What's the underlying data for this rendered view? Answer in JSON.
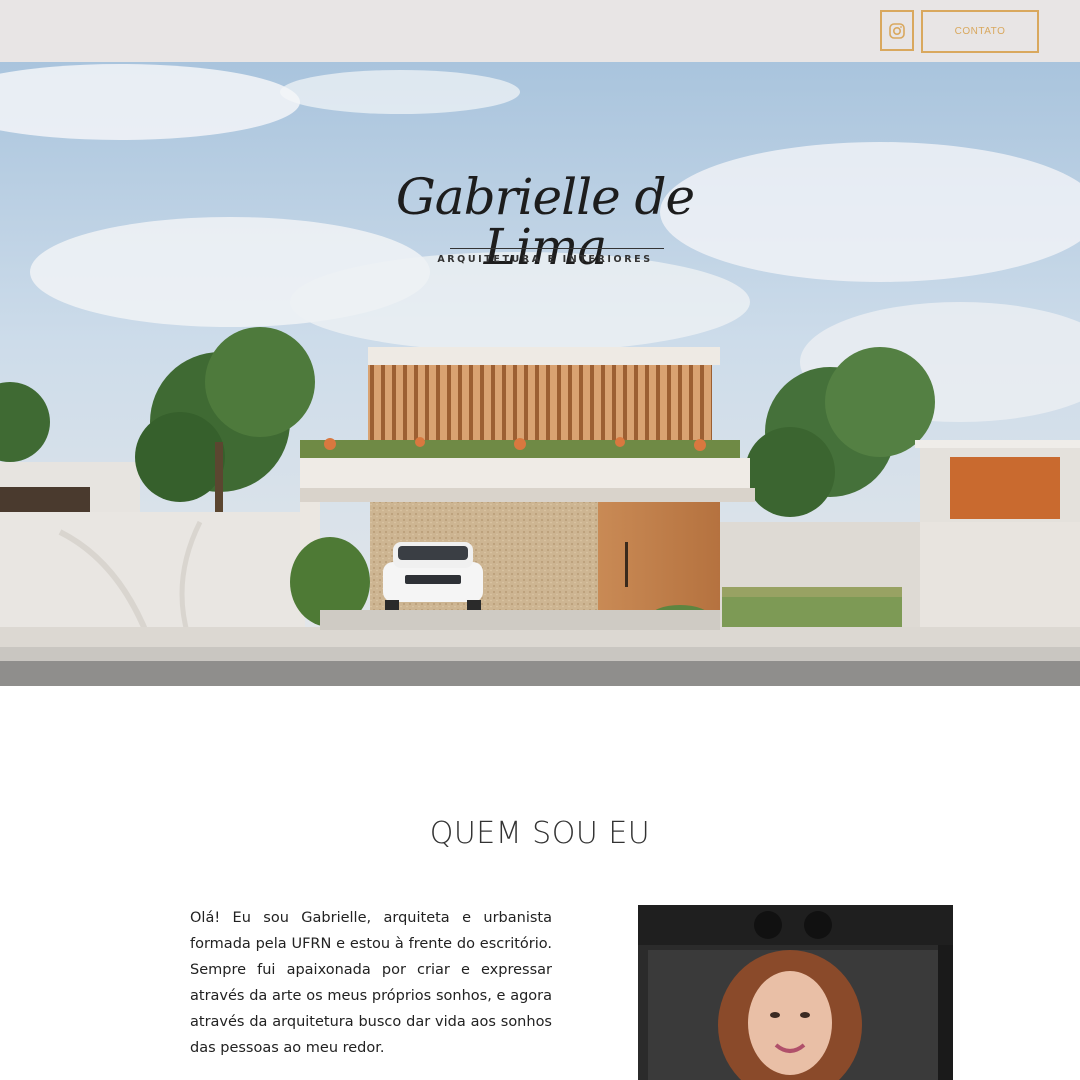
{
  "header": {
    "instagram_icon": "instagram-icon",
    "contact_label": "CONTATO",
    "accent_color": "#d9a85e"
  },
  "hero": {
    "logo_script": "Gabrielle de Lima",
    "logo_subtitle": "ARQUITETURA E INTERIORES"
  },
  "about": {
    "title": "QUEM SOU EU",
    "paragraph": "Olá! Eu sou Gabrielle, arquiteta e urbanista formada pela UFRN e estou à frente do escritório. Sempre fui apaixonada por criar e expressar através da arte os meus próprios sonhos, e agora através da arquitetura busco dar vida aos sonhos das pessoas ao meu redor."
  }
}
